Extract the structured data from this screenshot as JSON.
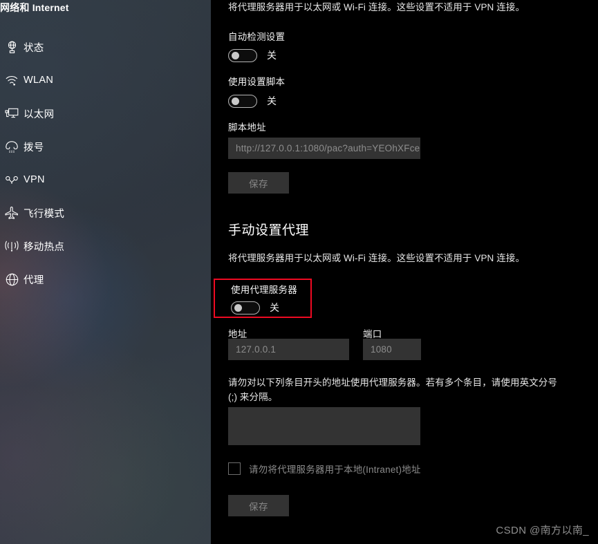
{
  "sidebar": {
    "title": "网络和 Internet",
    "items": [
      {
        "label": "状态",
        "icon": "network-status-icon"
      },
      {
        "label": "WLAN",
        "icon": "wifi-icon"
      },
      {
        "label": "以太网",
        "icon": "ethernet-icon"
      },
      {
        "label": "拨号",
        "icon": "dialup-phone-icon"
      },
      {
        "label": "VPN",
        "icon": "vpn-icon"
      },
      {
        "label": "飞行模式",
        "icon": "airplane-icon"
      },
      {
        "label": "移动热点",
        "icon": "hotspot-icon"
      },
      {
        "label": "代理",
        "icon": "globe-icon"
      }
    ]
  },
  "main": {
    "auto_setup": {
      "description": "将代理服务器用于以太网或 Wi-Fi 连接。这些设置不适用于 VPN 连接。",
      "auto_detect_label": "自动检测设置",
      "auto_detect_state": "关",
      "use_script_label": "使用设置脚本",
      "use_script_state": "关",
      "script_address_label": "脚本地址",
      "script_address_placeholder": "http://127.0.0.1:1080/pac?auth=YEOhXFce",
      "script_address_value": "",
      "save_label": "保存"
    },
    "manual_setup": {
      "heading": "手动设置代理",
      "description": "将代理服务器用于以太网或 Wi-Fi 连接。这些设置不适用于 VPN 连接。",
      "use_proxy_label": "使用代理服务器",
      "use_proxy_state": "关",
      "address_label": "地址",
      "address_placeholder": "127.0.0.1",
      "address_value": "",
      "port_label": "端口",
      "port_placeholder": "1080",
      "port_value": "",
      "exceptions_description": "请勿对以下列条目开头的地址使用代理服务器。若有多个条目，请使用英文分号 (;) 来分隔。",
      "exceptions_value": "",
      "bypass_local_label": "请勿将代理服务器用于本地(Intranet)地址",
      "bypass_local_checked": false,
      "save_label": "保存"
    }
  },
  "annotation": {
    "highlight_color": "#ef0a22"
  },
  "watermark": {
    "text": "CSDN @南方以南_"
  }
}
